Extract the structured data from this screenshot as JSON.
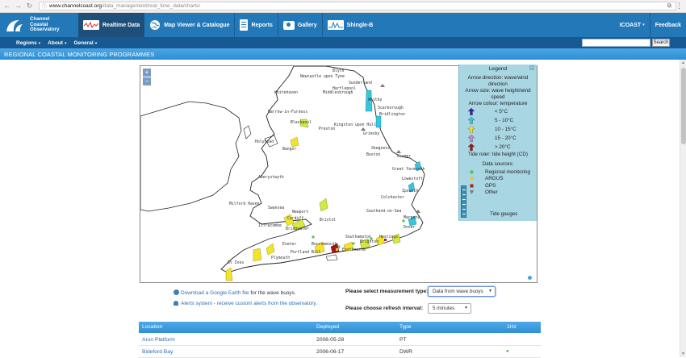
{
  "browser": {
    "back": "←",
    "forward": "→",
    "reload": "↻",
    "url_host": "www.channelcoast.org",
    "url_path": "/data_management/real_time_data/charts/"
  },
  "logo": {
    "line1": "Channel",
    "line2": "Coastal",
    "line3": "Observatory"
  },
  "nav": {
    "realtime": "Realtime Data",
    "map": "Map Viewer & Catalogue",
    "reports": "Reports",
    "gallery": "Gallery",
    "shingle": "Shingle-B",
    "icoast": "ICOAST",
    "feedback": "Feedback"
  },
  "subnav": {
    "regions": "Regions",
    "about": "About",
    "general": "General",
    "caret": "▾",
    "search_button": "Search",
    "search_value": ""
  },
  "banner": "REGIONAL COASTAL MONITORING PROGRAMMES",
  "map": {
    "zoom_in": "+",
    "zoom_out": "−",
    "places": [
      "Blyth",
      "Newcastle upon Tyne",
      "Sunderland",
      "Hartlepool",
      "Middlesbrough",
      "Whitehaven",
      "Whitby",
      "Scarborough",
      "Barrow-in-Furness",
      "Bridlington",
      "Blackpool",
      "Preston",
      "Kingston upon Hull",
      "Grimsby",
      "Holyhead",
      "Bangor",
      "Skegness",
      "Boston",
      "Cromer",
      "Great Yarmouth",
      "Lowestoft",
      "Aberystwyth",
      "Ipswich",
      "Colchester",
      "Milford Haven",
      "Swansea",
      "Newport",
      "Cardiff",
      "Bristol",
      "Southend-on-Sea",
      "Margate",
      "Ilfracombe",
      "Dover",
      "Bridgwater",
      "Exeter",
      "Southampton",
      "Bournemouth",
      "Brighton",
      "Hastings",
      "Eastbourne",
      "Plymouth",
      "Portland Bill",
      "St Ives"
    ]
  },
  "legend": {
    "title": "Legend",
    "close": "–",
    "arrow_direction": "Arrow direction: wave/wind direction",
    "arrow_size": "Arrow size: wave height/wind speed",
    "arrow_colour": "Arrow colour: temperature",
    "temps": [
      {
        "label": "< 5°C",
        "color": "#3a1fa8"
      },
      {
        "label": "5 - 10°C",
        "color": "#36c6dd"
      },
      {
        "label": "10 - 15°C",
        "color": "#f3e428"
      },
      {
        "label": "15 - 20°C",
        "color": "#d082d4"
      },
      {
        "label": "> 20°C",
        "color": "#a3141d"
      }
    ],
    "tide_ruler": "Tide ruler: tide height (CD)",
    "sources_title": "Data sources:",
    "sources": [
      {
        "label": "Regional monitoring",
        "color": "#55c255"
      },
      {
        "label": "ARGUS",
        "color": "#e7c53a"
      },
      {
        "label": "GPS",
        "color": "#a02525"
      },
      {
        "label": "Other",
        "color": "#777777"
      }
    ],
    "tide_gauges": "Tide gauges"
  },
  "controls": {
    "earth_link": "Download a Google Earth file",
    "earth_suffix": " for the wave buoys.",
    "alerts_link": "Alerts system - receive custom alerts from the observatory.",
    "measurement_label": "Please select measurement type:",
    "measurement_value": "Data from wave buoys",
    "refresh_label": "Please choose refresh interval:",
    "refresh_value": "5 minutes"
  },
  "table": {
    "headers": [
      "Location",
      "Deployed",
      "Type",
      "1Hz"
    ],
    "rows": [
      {
        "location": "Arun Platform",
        "deployed": "2008-05-28",
        "type": "PT",
        "hz": ""
      },
      {
        "location": "Bideford Bay",
        "deployed": "2006-06-17",
        "type": "DWR",
        "hz": "●"
      }
    ]
  },
  "colors": {
    "nav_bg": "#2378b8",
    "nav_active": "#1d4f7a",
    "subnav_bg": "#175a93",
    "banner": "#3a9bdc",
    "legend_bg": "#a9d6e3",
    "link": "#2a6eb4"
  }
}
